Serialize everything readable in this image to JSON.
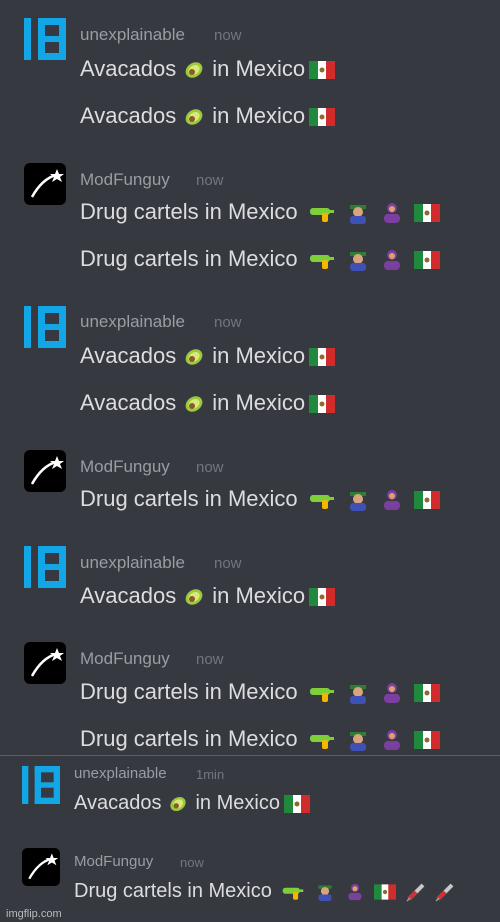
{
  "users": {
    "u": "unexplainable",
    "m": "ModFunguy"
  },
  "times": {
    "now": "now",
    "one_min": "1min"
  },
  "texts": {
    "avocados": "Avacados",
    "in_mexico": "in Mexico",
    "cartels": "Drug cartels in Mexico"
  },
  "watermark": "imgflip.com",
  "colors": {
    "background": "#36393f",
    "unexplainable_logo": "#12a6e6",
    "modfunguy_avatar": "#000000"
  }
}
